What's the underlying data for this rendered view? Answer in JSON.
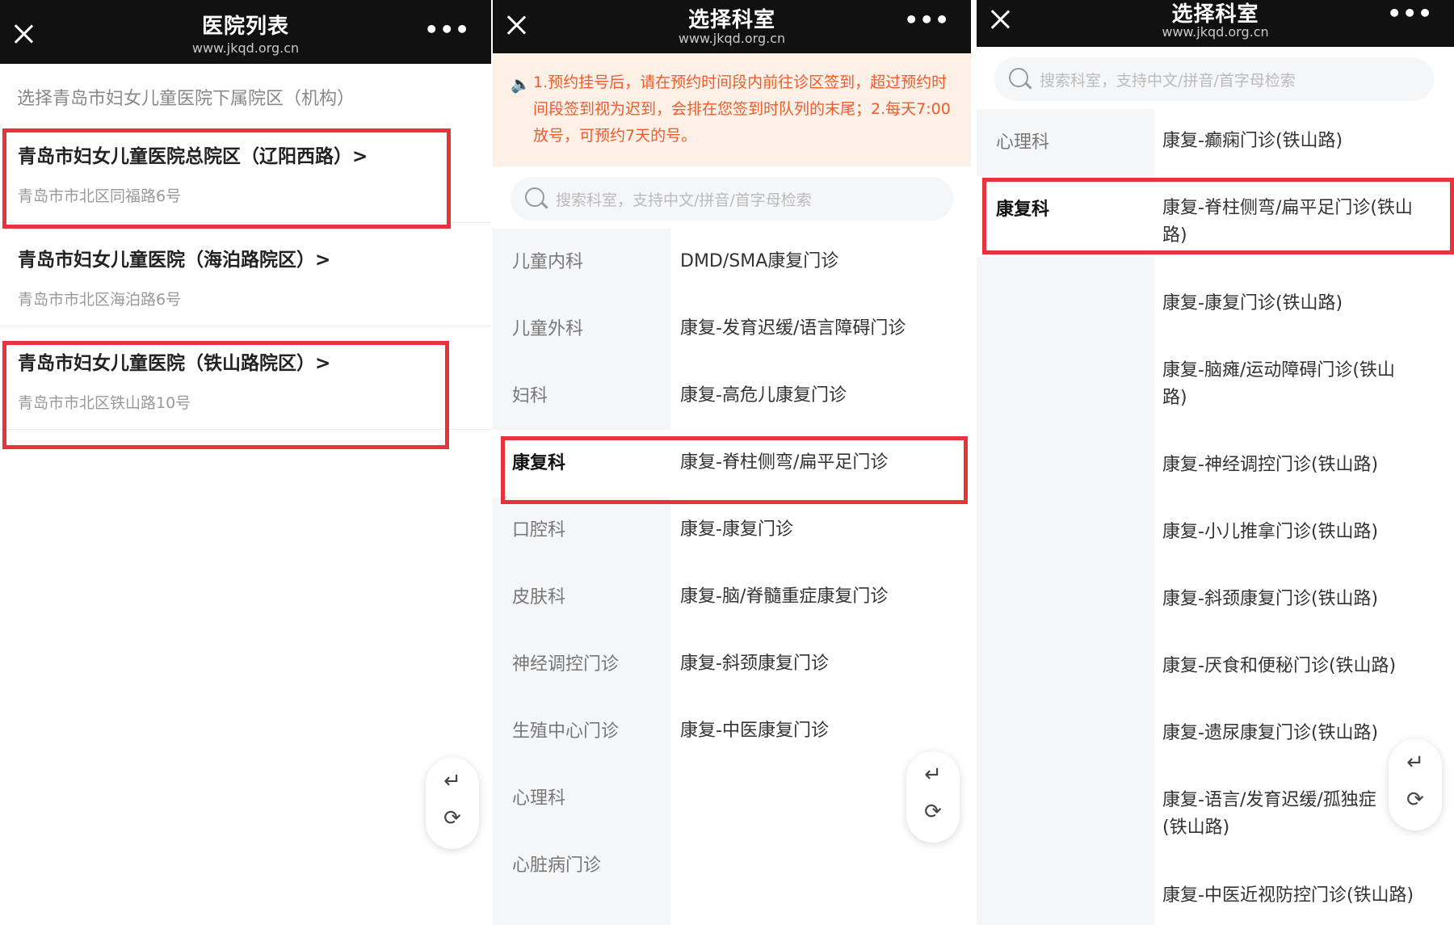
{
  "panel1": {
    "header": {
      "title": "医院列表",
      "url": "www.jkqd.org.cn"
    },
    "subtitle": "选择青岛市妇女儿童医院下属院区（机构）",
    "hospitals": [
      {
        "name": "青岛市妇女儿童医院总院区（辽阳西路）>",
        "address": "青岛市市北区同福路6号"
      },
      {
        "name": "青岛市妇女儿童医院（海泊路院区）>",
        "address": "青岛市市北区海泊路6号"
      },
      {
        "name": "青岛市妇女儿童医院（铁山路院区）>",
        "address": "青岛市市北区铁山路10号"
      }
    ]
  },
  "panel2": {
    "header": {
      "title": "选择科室",
      "url": "www.jkqd.org.cn"
    },
    "notice": "1.预约挂号后，请在预约时间段内前往诊区签到，超过预约时间段签到视为迟到，会排在您签到时队列的末尾；2.每天7:00放号，可预约7天的号。",
    "search_placeholder": "搜索科室，支持中文/拼音/首字母检索",
    "departments": [
      "儿童内科",
      "儿童外科",
      "妇科",
      "康复科",
      "口腔科",
      "皮肤科",
      "神经调控门诊",
      "生殖中心门诊",
      "心理科",
      "心脏病门诊"
    ],
    "active_department": "康复科",
    "clinics": [
      "DMD/SMA康复门诊",
      "康复-发育迟缓/语言障碍门诊",
      "康复-高危儿康复门诊",
      "康复-脊柱侧弯/扁平足门诊",
      "康复-康复门诊",
      "康复-脑/脊髓重症康复门诊",
      "康复-斜颈康复门诊",
      "康复-中医康复门诊"
    ]
  },
  "panel3": {
    "header": {
      "title": "选择科室",
      "url": "www.jkqd.org.cn"
    },
    "search_placeholder": "搜索科室，支持中文/拼音/首字母检索",
    "departments": [
      "心理科",
      "康复科"
    ],
    "active_department": "康复科",
    "clinics": [
      [
        "康复-癫痫门诊(铁山路)"
      ],
      [
        "康复-脊柱侧弯/扁平足门诊(铁山",
        "路)"
      ],
      [
        "康复-康复门诊(铁山路)"
      ],
      [
        "康复-脑瘫/运动障碍门诊(铁山",
        "路)"
      ],
      [
        "康复-神经调控门诊(铁山路)"
      ],
      [
        "康复-小儿推拿门诊(铁山路)"
      ],
      [
        "康复-斜颈康复门诊(铁山路)"
      ],
      [
        "康复-厌食和便秘门诊(铁山路)"
      ],
      [
        "康复-遗尿康复门诊(铁山路)"
      ],
      [
        "康复-语言/发育迟缓/孤独症",
        "(铁山路)"
      ],
      [
        "康复-中医近视防控门诊(铁山路)"
      ]
    ]
  },
  "tools": {
    "back_icon": "↵",
    "refresh_icon": "⟳"
  },
  "colors": {
    "header_bg": "#111111",
    "highlight": "#e8333a",
    "notice_text": "#f05b2b",
    "notice_bg": "#fdf0e7"
  }
}
